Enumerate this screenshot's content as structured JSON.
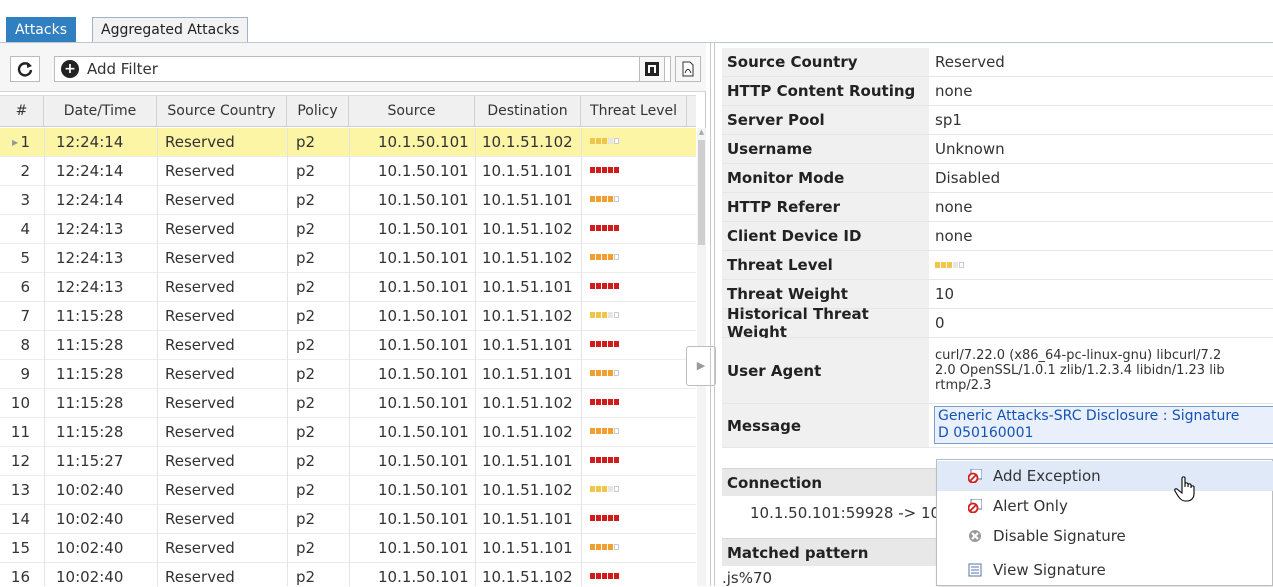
{
  "tabs": {
    "attacks": "Attacks",
    "aggregated": "Aggregated Attacks"
  },
  "toolbar": {
    "add_filter": "Add Filter"
  },
  "columns": [
    "#",
    "Date/Time",
    "Source Country",
    "Policy",
    "Source",
    "Destination",
    "Threat Level"
  ],
  "rows": [
    {
      "num": "1",
      "time": "12:24:14",
      "country": "Reserved",
      "policy": "p2",
      "src": "10.1.50.101",
      "dst": "10.1.51.102",
      "level": 3
    },
    {
      "num": "2",
      "time": "12:24:14",
      "country": "Reserved",
      "policy": "p2",
      "src": "10.1.50.101",
      "dst": "10.1.51.101",
      "level": 5
    },
    {
      "num": "3",
      "time": "12:24:14",
      "country": "Reserved",
      "policy": "p2",
      "src": "10.1.50.101",
      "dst": "10.1.51.101",
      "level": 4
    },
    {
      "num": "4",
      "time": "12:24:13",
      "country": "Reserved",
      "policy": "p2",
      "src": "10.1.50.101",
      "dst": "10.1.51.102",
      "level": 5
    },
    {
      "num": "5",
      "time": "12:24:13",
      "country": "Reserved",
      "policy": "p2",
      "src": "10.1.50.101",
      "dst": "10.1.51.102",
      "level": 4
    },
    {
      "num": "6",
      "time": "12:24:13",
      "country": "Reserved",
      "policy": "p2",
      "src": "10.1.50.101",
      "dst": "10.1.51.101",
      "level": 5
    },
    {
      "num": "7",
      "time": "11:15:28",
      "country": "Reserved",
      "policy": "p2",
      "src": "10.1.50.101",
      "dst": "10.1.51.102",
      "level": 3
    },
    {
      "num": "8",
      "time": "11:15:28",
      "country": "Reserved",
      "policy": "p2",
      "src": "10.1.50.101",
      "dst": "10.1.51.101",
      "level": 5
    },
    {
      "num": "9",
      "time": "11:15:28",
      "country": "Reserved",
      "policy": "p2",
      "src": "10.1.50.101",
      "dst": "10.1.51.101",
      "level": 4
    },
    {
      "num": "10",
      "time": "11:15:28",
      "country": "Reserved",
      "policy": "p2",
      "src": "10.1.50.101",
      "dst": "10.1.51.102",
      "level": 5
    },
    {
      "num": "11",
      "time": "11:15:28",
      "country": "Reserved",
      "policy": "p2",
      "src": "10.1.50.101",
      "dst": "10.1.51.102",
      "level": 4
    },
    {
      "num": "12",
      "time": "11:15:27",
      "country": "Reserved",
      "policy": "p2",
      "src": "10.1.50.101",
      "dst": "10.1.51.101",
      "level": 5
    },
    {
      "num": "13",
      "time": "10:02:40",
      "country": "Reserved",
      "policy": "p2",
      "src": "10.1.50.101",
      "dst": "10.1.51.102",
      "level": 3
    },
    {
      "num": "14",
      "time": "10:02:40",
      "country": "Reserved",
      "policy": "p2",
      "src": "10.1.50.101",
      "dst": "10.1.51.101",
      "level": 5
    },
    {
      "num": "15",
      "time": "10:02:40",
      "country": "Reserved",
      "policy": "p2",
      "src": "10.1.50.101",
      "dst": "10.1.51.101",
      "level": 4
    },
    {
      "num": "16",
      "time": "10:02:40",
      "country": "Reserved",
      "policy": "p2",
      "src": "10.1.50.101",
      "dst": "10.1.51.102",
      "level": 5
    }
  ],
  "level_colors": {
    "3": "#f0c64a",
    "4": "#f0a030",
    "5": "#d01c1c",
    "empty": "#e6e6e6"
  },
  "details": {
    "source_country": {
      "key": "Source Country",
      "value": "Reserved"
    },
    "http_content_routing": {
      "key": "HTTP Content Routing",
      "value": "none"
    },
    "server_pool": {
      "key": "Server Pool",
      "value": "sp1"
    },
    "username": {
      "key": "Username",
      "value": "Unknown"
    },
    "monitor_mode": {
      "key": "Monitor Mode",
      "value": "Disabled"
    },
    "http_referer": {
      "key": "HTTP Referer",
      "value": "none"
    },
    "client_device_id": {
      "key": "Client Device ID",
      "value": "none"
    },
    "threat_level": {
      "key": "Threat Level",
      "level": 3
    },
    "threat_weight": {
      "key": "Threat Weight",
      "value": "10"
    },
    "historical_threat_weight": {
      "key": "Historical Threat Weight",
      "value": "0"
    },
    "user_agent": {
      "key": "User Agent",
      "line1": "curl/7.22.0 (x86_64-pc-linux-gnu) libcurl/7.2",
      "line2": "2.0 OpenSSL/1.0.1 zlib/1.2.3.4 libidn/1.23 lib",
      "line3": "rtmp/2.3"
    },
    "message": {
      "key": "Message",
      "line1": "Generic Attacks-SRC Disclosure : Signature",
      "line2": "D 050160001"
    }
  },
  "sections": {
    "connection": "Connection",
    "matched_pattern": "Matched pattern"
  },
  "connection_value": "10.1.50.101:59928 -> 10",
  "matched_value": ".js%70",
  "context_menu": {
    "add_exception": "Add Exception",
    "alert_only": "Alert Only",
    "disable_signature": "Disable Signature",
    "view_signature": "View Signature"
  }
}
